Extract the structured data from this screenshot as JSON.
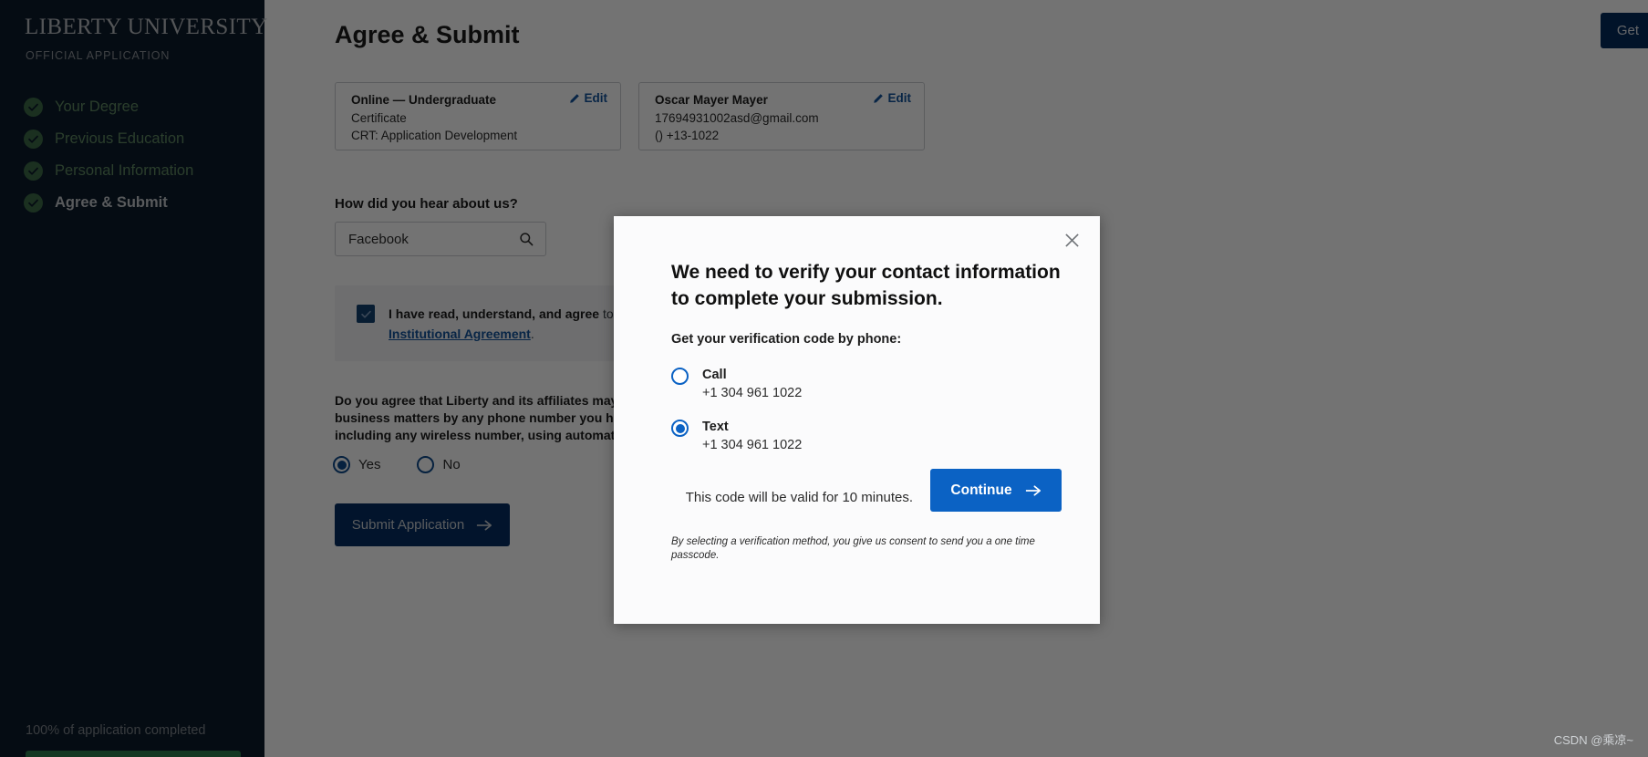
{
  "sidebar": {
    "brand": "LIBERTY UNIVERSITY",
    "brand_subtitle": "OFFICIAL APPLICATION",
    "items": [
      {
        "label": "Your Degree",
        "icon": "check-circle-icon",
        "state": "complete"
      },
      {
        "label": "Previous Education",
        "icon": "check-circle-icon",
        "state": "complete"
      },
      {
        "label": "Personal Information",
        "icon": "check-circle-icon",
        "state": "complete"
      },
      {
        "label": "Agree & Submit",
        "icon": "check-circle-icon",
        "state": "active"
      }
    ],
    "progress_label": "100% of application completed",
    "progress_percent": 100,
    "colors": {
      "background": "#0c1b2a",
      "check": "#3c6b47",
      "link": "#5f8a63",
      "bar": "#2e7d4f"
    }
  },
  "page": {
    "title": "Agree & Submit",
    "top_right_button": "Get",
    "cards": [
      {
        "name": "Online — Undergraduate",
        "line1": "Certificate",
        "line2": "CRT: Application Development",
        "edit_label": "Edit",
        "edit_icon": "pencil-icon"
      },
      {
        "name": "Oscar Mayer Mayer",
        "line1": "17694931002asd@gmail.com",
        "line2": "() +13-1022",
        "edit_label": "Edit",
        "edit_icon": "pencil-icon"
      }
    ],
    "hear_about": {
      "label": "How did you hear about us?",
      "value": "Facebook",
      "icon": "search-icon"
    },
    "agreement": {
      "checked": true,
      "bold_part": "I have read, understand, and agree",
      "rest_part": " to the te",
      "link_text": "Institutional Agreement",
      "trailing": "."
    },
    "consent": {
      "question_line1": "Do you agree that Liberty and its affiliates may",
      "question_line2": "business matters by any phone number you hav",
      "question_line3": "including any wireless number, using automate",
      "options": [
        {
          "label": "Yes",
          "selected": true
        },
        {
          "label": "No",
          "selected": false
        }
      ]
    },
    "submit_button": {
      "label": "Submit Application",
      "icon": "arrow-right-icon"
    }
  },
  "modal": {
    "close_icon": "close-icon",
    "title": "We need to verify your contact information to complete your submission.",
    "subtitle": "Get your verification code by phone:",
    "options": [
      {
        "label": "Call",
        "phone": "+1 304 961 1022",
        "selected": false
      },
      {
        "label": "Text",
        "phone": "+1 304 961 1022",
        "selected": true
      }
    ],
    "validity_text": "This code will be valid for 10 minutes.",
    "continue_button": {
      "label": "Continue",
      "icon": "arrow-right-icon"
    },
    "footnote": "By selecting a verification method, you give us consent to send you a one time passcode.",
    "accent_color": "#0b62c4"
  },
  "watermark": "CSDN @乘凉~"
}
